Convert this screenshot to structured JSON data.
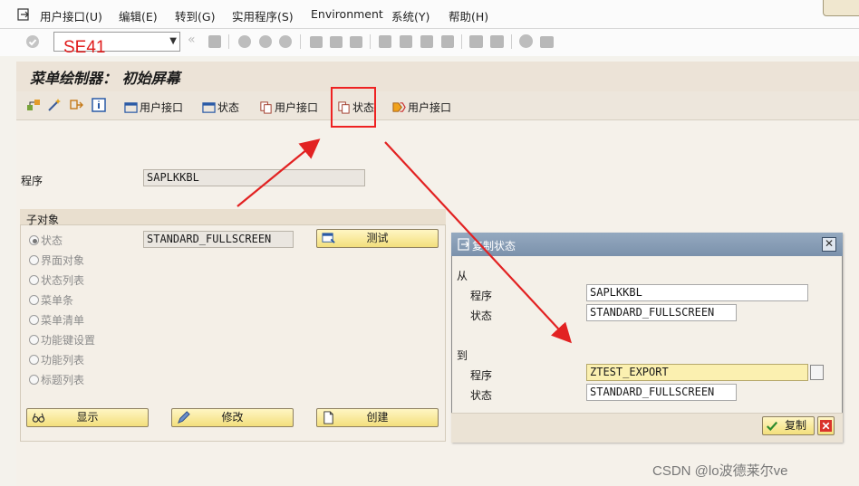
{
  "menu": {
    "items": [
      "用户接口(U)",
      "编辑(E)",
      "转到(G)",
      "实用程序(S)",
      "Environment",
      "系统(Y)",
      "帮助(H)"
    ]
  },
  "toolbar": {
    "okcode_value": "SE41"
  },
  "screen": {
    "title": "菜单绘制器： 初始屏幕",
    "app_buttons": [
      "用户接口",
      "状态",
      "用户接口",
      "状态",
      "用户接口"
    ],
    "program_label": "程序",
    "program_value": "SAPLKKBL",
    "subobjects": {
      "title": "子对象",
      "options": [
        "状态",
        "界面对象",
        "状态列表",
        "菜单条",
        "菜单清单",
        "功能键设置",
        "功能列表",
        "标题列表"
      ],
      "selected_index": 0,
      "status_value": "STANDARD_FULLSCREEN",
      "test_button": "测试"
    },
    "bottom_buttons": {
      "display": "显示",
      "change": "修改",
      "create": "创建"
    }
  },
  "dialog": {
    "title": "复制状态",
    "from_label": "从",
    "from_program_label": "程序",
    "from_program_value": "SAPLKKBL",
    "from_status_label": "状态",
    "from_status_value": "STANDARD_FULLSCREEN",
    "to_label": "到",
    "to_program_label": "程序",
    "to_program_value": "ZTEST_EXPORT",
    "to_status_label": "状态",
    "to_status_value": "STANDARD_FULLSCREEN",
    "copy_button": "复制"
  },
  "watermark": "CSDN @lo波德莱尔ve",
  "colors": {
    "highlight": "#e22222",
    "button_yellow": "#f3df7c",
    "dialog_header": "#7b91ab"
  }
}
